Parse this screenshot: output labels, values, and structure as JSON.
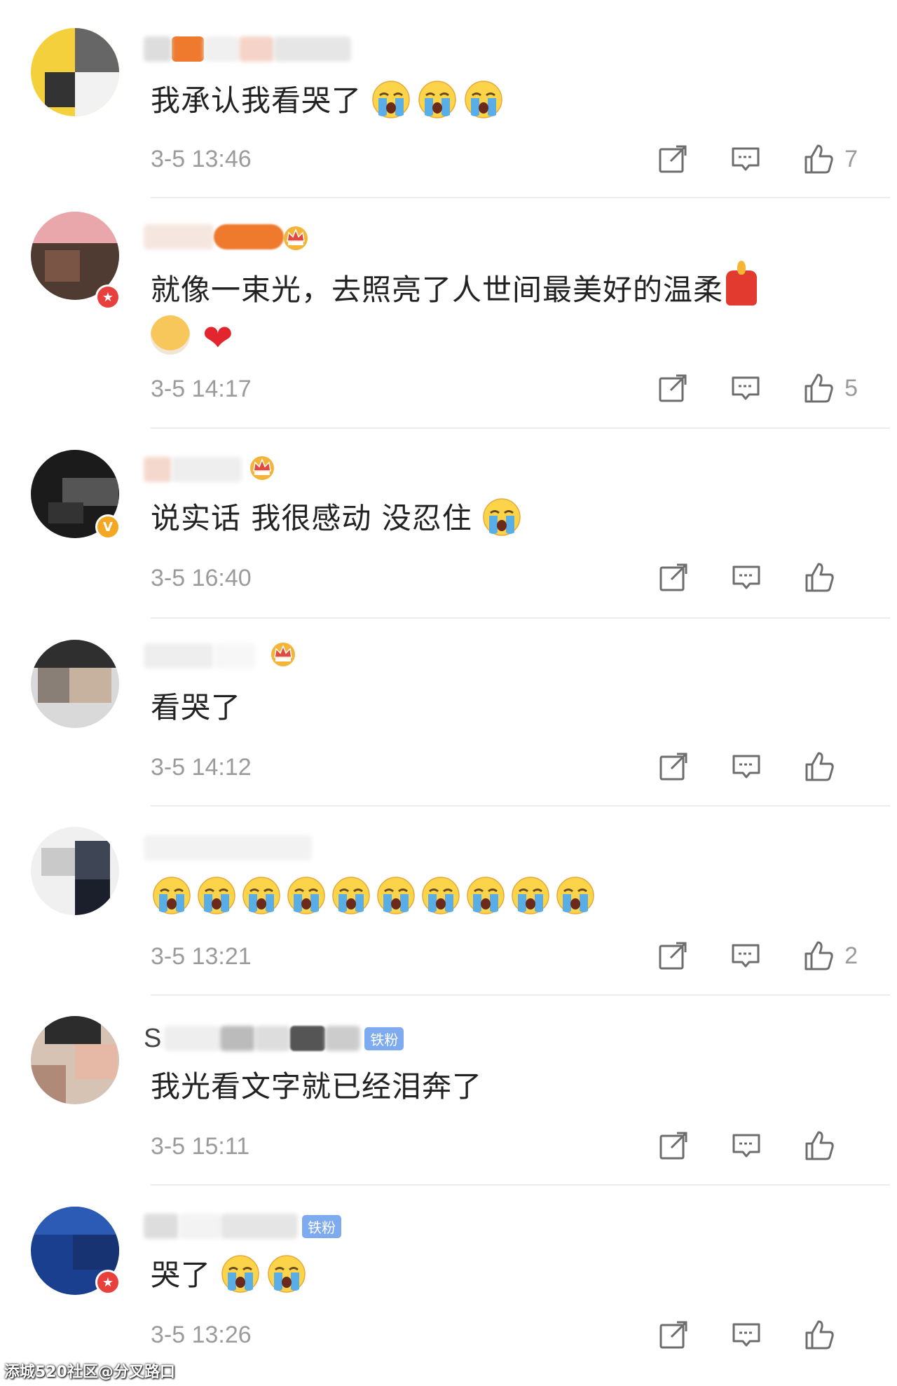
{
  "comments": [
    {
      "text": "我承认我看哭了",
      "emoji_count": 3,
      "heart": false,
      "candle": false,
      "time": "3-5 13:46",
      "likes": "7"
    },
    {
      "text": "就像一束光，去照亮了人世间最美好的温柔",
      "emoji_count": 0,
      "heart": true,
      "candle": true,
      "time": "3-5 14:17",
      "likes": "5"
    },
    {
      "text": "说实话 我很感动 没忍住",
      "emoji_count": 1,
      "heart": false,
      "candle": false,
      "time": "3-5 16:40",
      "likes": ""
    },
    {
      "text": "看哭了",
      "emoji_count": 0,
      "heart": false,
      "candle": false,
      "time": "3-5 14:12",
      "likes": ""
    },
    {
      "text": "",
      "emoji_count": 10,
      "heart": false,
      "candle": false,
      "time": "3-5 13:21",
      "likes": "2"
    },
    {
      "name_prefix": "S",
      "fan_badge": "铁粉",
      "text": "我光看文字就已经泪奔了",
      "emoji_count": 0,
      "time": "3-5 15:11",
      "likes": ""
    },
    {
      "fan_badge": "铁粉",
      "text": "哭了",
      "emoji_count": 2,
      "time": "3-5 13:26",
      "likes": ""
    }
  ],
  "icons": {
    "share": "share-icon",
    "reply": "comment-icon",
    "like": "thumbs-up-icon",
    "crying": "crying-face-emoji"
  },
  "colors": {
    "time": "#9b9b9b",
    "fan_badge": "#7eaaf0",
    "badge_red": "#e8413d",
    "badge_gold": "#f5a623"
  },
  "watermark": "添城520社区@分叉路口"
}
